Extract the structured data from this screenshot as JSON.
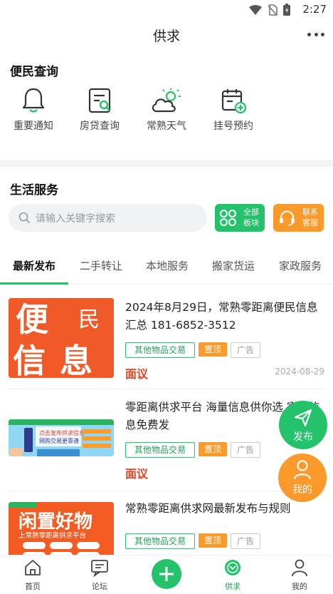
{
  "status_bar": {
    "time": "2:27"
  },
  "header": {
    "title": "供求"
  },
  "convenience": {
    "title": "便民查询",
    "items": [
      {
        "label": "重要通知",
        "icon": "bell-icon"
      },
      {
        "label": "房贷查询",
        "icon": "document-search-icon"
      },
      {
        "label": "常熟天气",
        "icon": "weather-icon"
      },
      {
        "label": "挂号预约",
        "icon": "calendar-plus-icon"
      }
    ]
  },
  "life": {
    "title": "生活服务",
    "search_placeholder": "请输入关键字搜索",
    "all_sections": "全部板块",
    "contact_service": "联系客服"
  },
  "tabs": [
    "最新发布",
    "二手转让",
    "本地服务",
    "搬家货运",
    "家政服务"
  ],
  "listings": [
    {
      "title": "2024年8月29日，常熟零距离便民信息汇总 181-6852-3512",
      "category": "其他物品交易",
      "top": "置顶",
      "ad": "广告",
      "price": "面议",
      "date": "2024-08-29",
      "thumb_text": [
        "便",
        "民",
        "信",
        "息"
      ]
    },
    {
      "title": "零距离供求平台 海量信息供你选 宣传信息免费发",
      "category": "其他物品交易",
      "top": "置顶",
      "ad": "广告",
      "price": "面议",
      "thumb_text": [
        "点击发布供求信息",
        "网购交易更靠谱"
      ]
    },
    {
      "title": "常熟零距离供求网最新发布与规则",
      "category": "其他物品交易",
      "top": "置顶",
      "ad": "广告",
      "thumb_text": [
        "闲置好物",
        "上常熟零距离供求平台"
      ]
    }
  ],
  "fab": {
    "publish": "发布",
    "mine": "我的"
  },
  "bottom_nav": [
    {
      "label": "首页",
      "icon": "home-icon"
    },
    {
      "label": "论坛",
      "icon": "forum-icon"
    },
    {
      "label": "",
      "icon": "plus-icon"
    },
    {
      "label": "供求",
      "icon": "supply-icon"
    },
    {
      "label": "我的",
      "icon": "profile-icon"
    }
  ],
  "colors": {
    "accent_green": "#23c26b",
    "accent_orange": "#fb9a2b",
    "price_red": "#e8431e"
  }
}
